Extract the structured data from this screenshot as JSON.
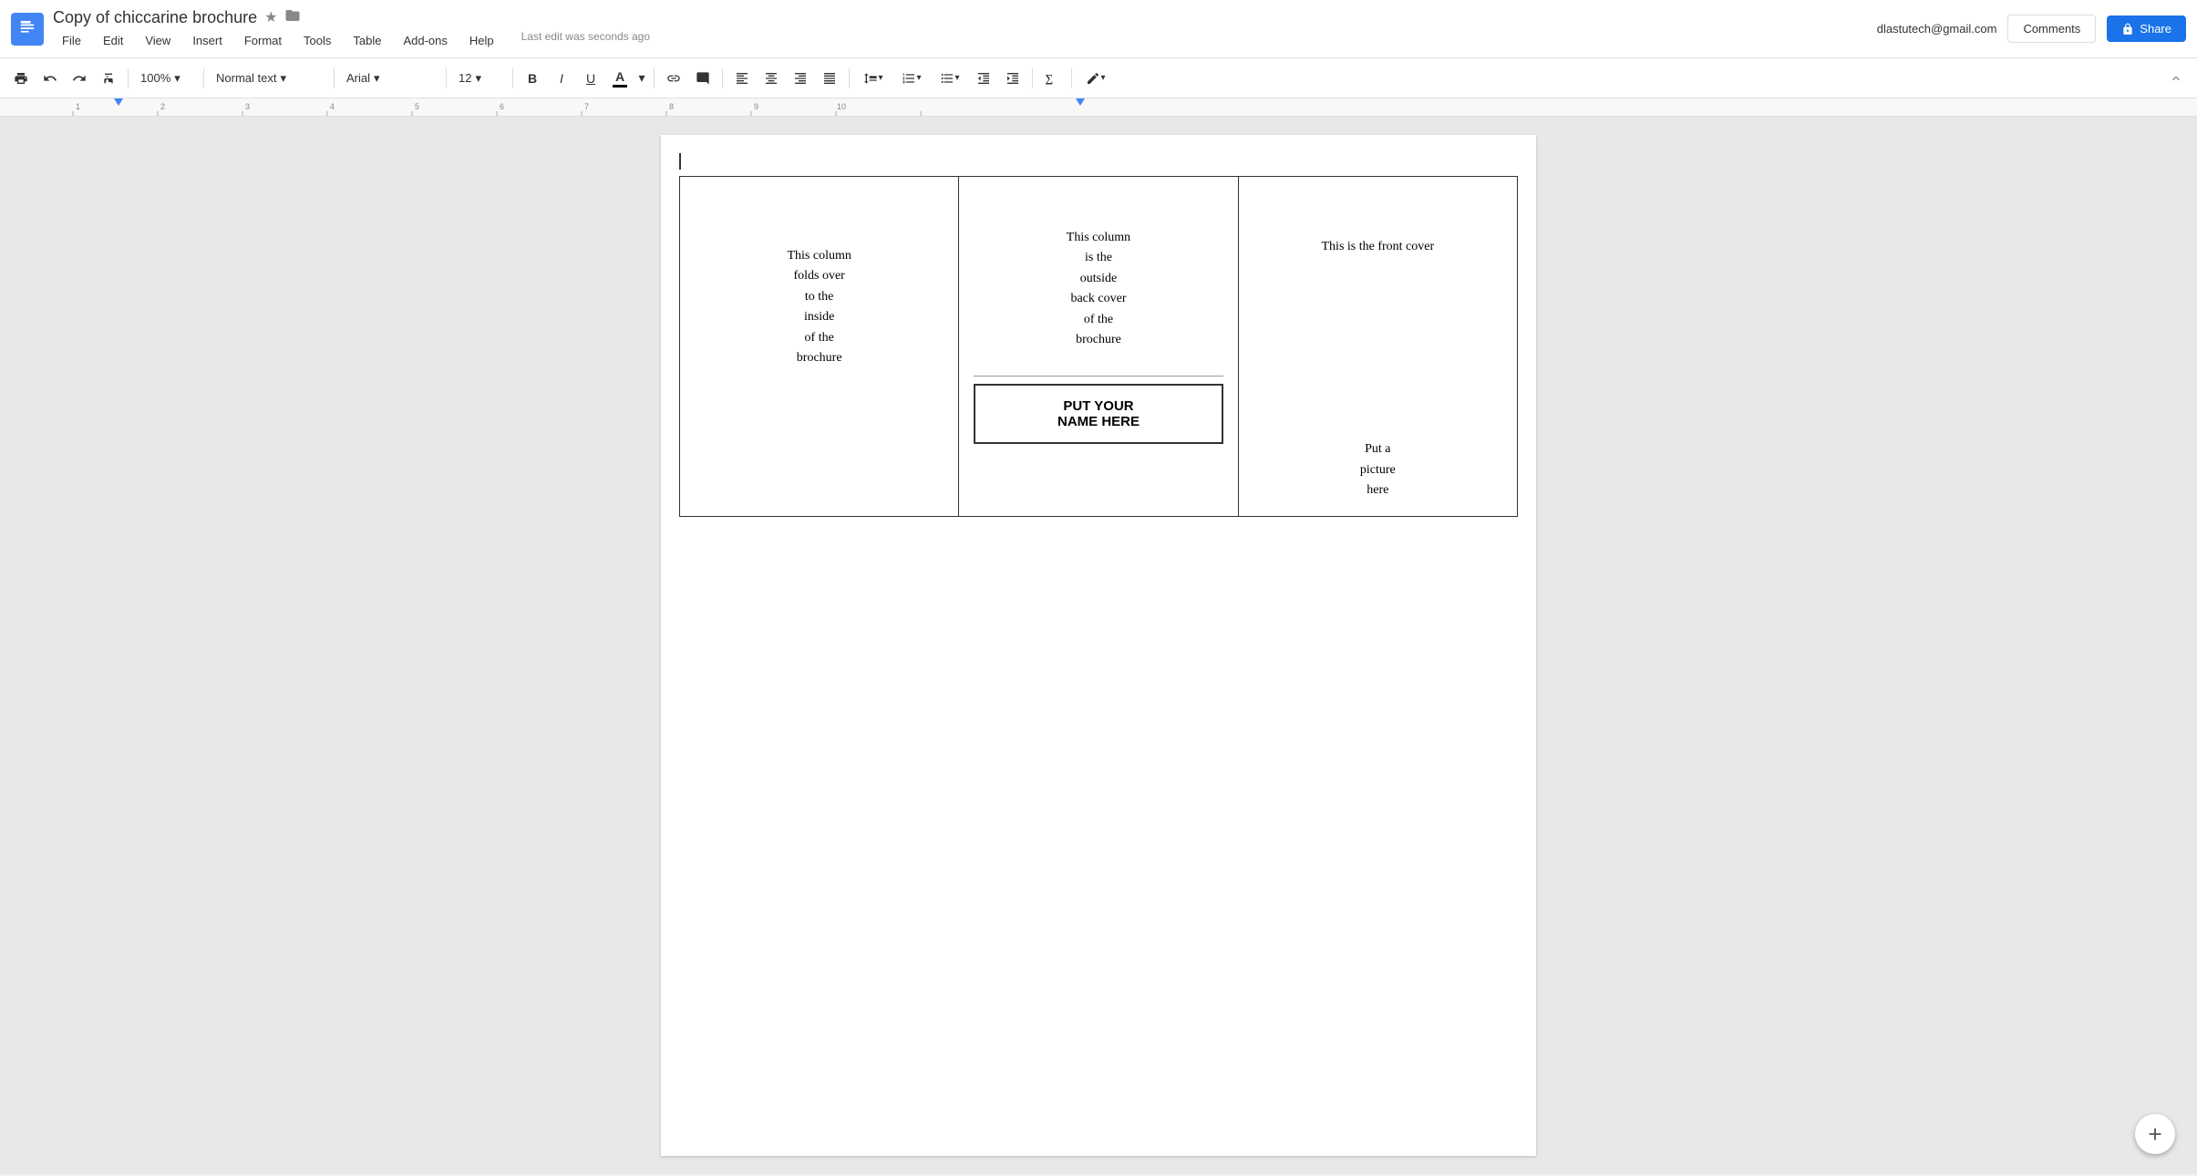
{
  "header": {
    "app_icon_label": "Docs",
    "doc_title": "Copy of chiccarine brochure",
    "star_icon": "★",
    "folder_icon": "📁",
    "last_edit": "Last edit was seconds ago",
    "user_email": "dlastutech@gmail.com",
    "comments_btn": "Comments",
    "share_btn": "Share"
  },
  "menu": {
    "items": [
      "File",
      "Edit",
      "View",
      "Insert",
      "Format",
      "Tools",
      "Table",
      "Add-ons",
      "Help"
    ]
  },
  "toolbar": {
    "zoom": "100%",
    "style": "Normal text",
    "font": "Arial",
    "size": "12",
    "bold": "B",
    "italic": "I",
    "underline": "U",
    "text_color": "A",
    "collapse_label": "▲"
  },
  "document": {
    "col1_text": "This column\nfolds over\nto the\ninside\nof the\nbrochure",
    "col2_text": "This column\nis the\noutside\nback cover\nof the\nbrochure",
    "col2_name": "PUT YOUR\nNAME HERE",
    "col3_title": "This is the front cover",
    "col3_picture": "Put a\npicture\nhere"
  }
}
